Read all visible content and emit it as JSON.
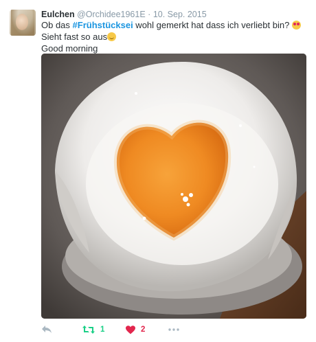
{
  "tweet": {
    "name": "Eulchen",
    "handle": "@Orchidee1961E",
    "separator": "·",
    "date": "10. Sep. 2015",
    "text_before_hashtag": "Ob das ",
    "hashtag": "#Frühstücksei",
    "text_after_hashtag": "  wohl gemerkt hat dass ich verliebt bin? ",
    "emoji_heart_eyes": "heart-eyes-emoji",
    "text_after_emoji": "Sieht fast so aus",
    "emoji_smile": "smiling-face-emoji",
    "second_line": "Good morning",
    "photo_icon": "boiled-egg-heart-yolk-photo"
  },
  "actions": {
    "reply_icon": "reply-icon",
    "retweet_icon": "retweet-icon",
    "retweet_count": "1",
    "like_icon": "heart-icon",
    "like_count": "2",
    "more_icon": "more-dots-icon"
  },
  "colors": {
    "retweet_active": "#19cf86",
    "like_active": "#e2264d",
    "hashtag": "#1b95e0",
    "muted": "#8899a6"
  }
}
